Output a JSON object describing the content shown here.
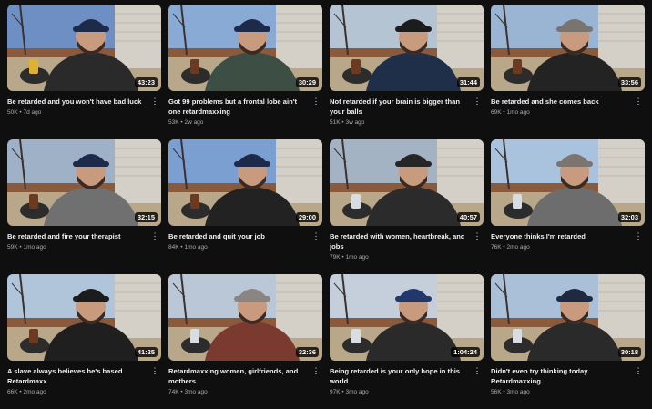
{
  "videos": [
    {
      "title": "Be retarded and you won't have bad luck",
      "views": "50K",
      "age": "7d ago",
      "duration": "43:23",
      "sky": "#6d8fc4",
      "hat": "#1e2a4a",
      "hoodie": "#2a2a2a",
      "prop": "#e0b030"
    },
    {
      "title": "Got 99 problems but a frontal lobe ain't one retardmaxxing",
      "views": "53K",
      "age": "2w ago",
      "duration": "30:29",
      "sky": "#8aaad6",
      "hat": "#1e2a4a",
      "hoodie": "#3d4f45",
      "prop": "#6b3a20"
    },
    {
      "title": "Not retarded if your brain is bigger than your balls",
      "views": "51K",
      "age": "3w ago",
      "duration": "31:44",
      "sky": "#b5c4d3",
      "hat": "#1c1c1c",
      "hoodie": "#1f2f4a",
      "prop": "#6b3a20"
    },
    {
      "title": "Be retarded and she comes back",
      "views": "69K",
      "age": "1mo ago",
      "duration": "33:56",
      "sky": "#9ab4d4",
      "hat": "#7a746e",
      "hoodie": "#232323",
      "prop": "#6b3a20"
    },
    {
      "title": "Be retarded and fire your therapist",
      "views": "59K",
      "age": "1mo ago",
      "duration": "32:15",
      "sky": "#9fb1c6",
      "hat": "#1e2a4a",
      "hoodie": "#707070",
      "prop": "#6b3a20"
    },
    {
      "title": "Be retarded and quit your job",
      "views": "84K",
      "age": "1mo ago",
      "duration": "29:00",
      "sky": "#7c9fd2",
      "hat": "#1e2a4a",
      "hoodie": "#222222",
      "prop": "#6b3a20"
    },
    {
      "title": "Be retarded with women, heartbreak, and jobs",
      "views": "79K",
      "age": "1mo ago",
      "duration": "40:57",
      "sky": "#a3b3c4",
      "hat": "#262626",
      "hoodie": "#2b2b2b",
      "prop": "#d8dde2"
    },
    {
      "title": "Everyone thinks I'm retarded",
      "views": "76K",
      "age": "2mo ago",
      "duration": "32:03",
      "sky": "#a9c2de",
      "hat": "#7b756e",
      "hoodie": "#6d6d6d",
      "prop": "#d8dde2"
    },
    {
      "title": "A slave always believes he's based Retardmaxx",
      "views": "66K",
      "age": "2mo ago",
      "duration": "41:25",
      "sky": "#b0c5da",
      "hat": "#1c1c1c",
      "hoodie": "#1f1f1f",
      "prop": "#6b3a20"
    },
    {
      "title": "Retardmaxxing women, girlfriends, and mothers",
      "views": "74K",
      "age": "3mo ago",
      "duration": "32:36",
      "sky": "#b9c7d6",
      "hat": "#8a8580",
      "hoodie": "#7a3a30",
      "prop": "#d8dde2"
    },
    {
      "title": "Being retarded is your only hope in this world",
      "views": "97K",
      "age": "3mo ago",
      "duration": "1:04:24",
      "sky": "#c4cfdb",
      "hat": "#22386b",
      "hoodie": "#2a2a2a",
      "prop": "#d8dde2"
    },
    {
      "title": "Didn't even try thinking today Retardmaxxing",
      "views": "56K",
      "age": "3mo ago",
      "duration": "30:18",
      "sky": "#aac0d8",
      "hat": "#1f2a40",
      "hoodie": "#2a2a2a",
      "prop": "#d8dde2"
    }
  ],
  "separator": " • ",
  "menu_icon": "more-vert-icon"
}
